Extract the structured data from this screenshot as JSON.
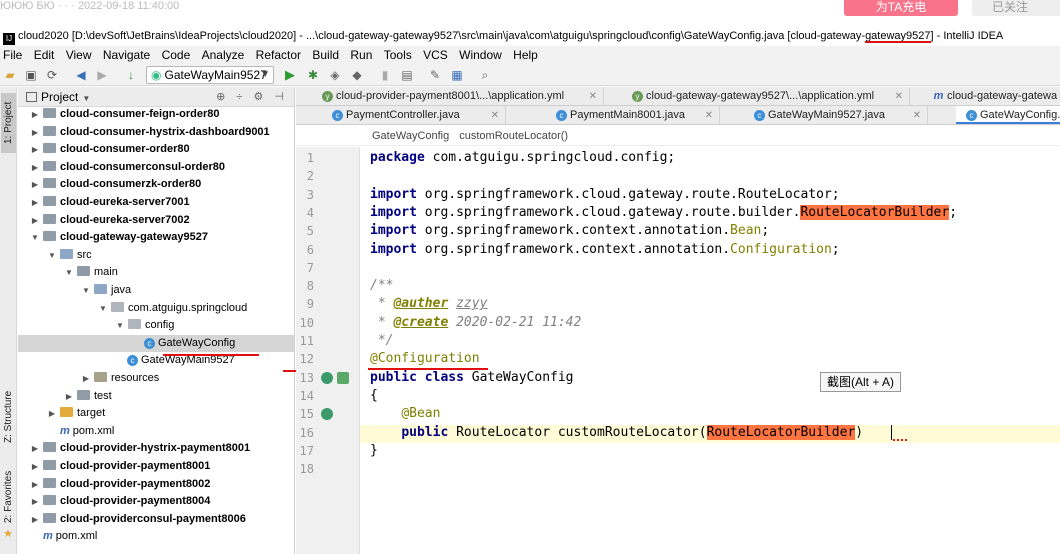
{
  "topstrip": {
    "faint_text": "ЮЮЮ  БЮ  ·  ·  ·  2022-09-18  11:40:00",
    "pink_button": "为TA充电",
    "grey_button": "已关注"
  },
  "window": {
    "title_prefix": "cloud2020 [D:\\devSoft\\JetBrains\\IdeaProjects\\cloud2020] - ...\\cloud-gateway-gateway9527\\src\\main\\java\\com\\atguigu\\springcloud\\config\\GateWayConfig.java [cloud-gateway-",
    "title_underlined": "gateway9527",
    "title_suffix": "] - IntelliJ IDEA"
  },
  "menu": [
    "File",
    "Edit",
    "View",
    "Navigate",
    "Code",
    "Analyze",
    "Refactor",
    "Build",
    "Run",
    "Tools",
    "VCS",
    "Window",
    "Help"
  ],
  "toolbar": {
    "run_config": "GateWayMain9527"
  },
  "side_tabs": {
    "project": "1: Project",
    "structure": "Z: Structure",
    "favorites": "2: Favorites"
  },
  "project_panel": {
    "title": "Project",
    "tree": [
      {
        "label": "cloud-consumer-feign-order80",
        "depth": 1,
        "kind": "module",
        "arrow": "▶"
      },
      {
        "label": "cloud-consumer-hystrix-dashboard9001",
        "depth": 1,
        "kind": "module",
        "arrow": "▶"
      },
      {
        "label": "cloud-consumer-order80",
        "depth": 1,
        "kind": "module",
        "arrow": "▶"
      },
      {
        "label": "cloud-consumerconsul-order80",
        "depth": 1,
        "kind": "module",
        "arrow": "▶"
      },
      {
        "label": "cloud-consumerzk-order80",
        "depth": 1,
        "kind": "module",
        "arrow": "▶"
      },
      {
        "label": "cloud-eureka-server7001",
        "depth": 1,
        "kind": "module",
        "arrow": "▶"
      },
      {
        "label": "cloud-eureka-server7002",
        "depth": 1,
        "kind": "module",
        "arrow": "▶"
      },
      {
        "label": "cloud-gateway-gateway9527",
        "depth": 1,
        "kind": "module",
        "arrow": "▼"
      },
      {
        "label": "src",
        "depth": 2,
        "kind": "src",
        "arrow": "▼"
      },
      {
        "label": "main",
        "depth": 3,
        "kind": "folder",
        "arrow": "▼"
      },
      {
        "label": "java",
        "depth": 4,
        "kind": "src",
        "arrow": "▼"
      },
      {
        "label": "com.atguigu.springcloud",
        "depth": 5,
        "kind": "pkg",
        "arrow": "▼"
      },
      {
        "label": "config",
        "depth": 6,
        "kind": "pkg",
        "arrow": "▼"
      },
      {
        "label": "GateWayConfig",
        "depth": 7,
        "kind": "class",
        "arrow": "",
        "selected": true
      },
      {
        "label": "GateWayMain9527",
        "depth": 6,
        "kind": "class",
        "arrow": ""
      },
      {
        "label": "resources",
        "depth": 4,
        "kind": "res",
        "arrow": "▶"
      },
      {
        "label": "test",
        "depth": 3,
        "kind": "folder",
        "arrow": "▶"
      },
      {
        "label": "target",
        "depth": 2,
        "kind": "target",
        "arrow": "▶"
      },
      {
        "label": "pom.xml",
        "depth": 2,
        "kind": "maven",
        "arrow": ""
      },
      {
        "label": "cloud-provider-hystrix-payment8001",
        "depth": 1,
        "kind": "module",
        "arrow": "▶"
      },
      {
        "label": "cloud-provider-payment8001",
        "depth": 1,
        "kind": "module",
        "arrow": "▶"
      },
      {
        "label": "cloud-provider-payment8002",
        "depth": 1,
        "kind": "module",
        "arrow": "▶"
      },
      {
        "label": "cloud-provider-payment8004",
        "depth": 1,
        "kind": "module",
        "arrow": "▶"
      },
      {
        "label": "cloud-providerconsul-payment8006",
        "depth": 1,
        "kind": "module",
        "arrow": "▶"
      },
      {
        "label": "pom.xml",
        "depth": 1,
        "kind": "maven",
        "arrow": ""
      }
    ]
  },
  "editor": {
    "tabs_row1": [
      {
        "label": "cloud-provider-payment8001\\...\\application.yml",
        "icon": "yml"
      },
      {
        "label": "cloud-gateway-gateway9527\\...\\application.yml",
        "icon": "yml"
      },
      {
        "label": "cloud-gateway-gatewa",
        "icon": "maven"
      }
    ],
    "tabs_row2": [
      {
        "label": "PaymentController.java",
        "icon": "class"
      },
      {
        "label": "PaymentMain8001.java",
        "icon": "class"
      },
      {
        "label": "GateWayMain9527.java",
        "icon": "class"
      },
      {
        "label": "GateWayConfig.j",
        "icon": "class",
        "active": true
      }
    ],
    "breadcrumb": [
      "GateWayConfig",
      "customRouteLocator()"
    ],
    "tooltip": "截图(Alt + A)"
  }
}
